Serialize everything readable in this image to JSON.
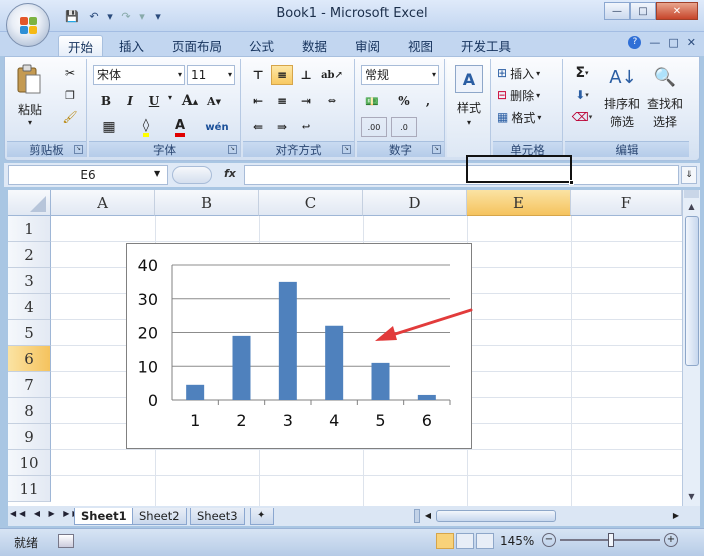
{
  "window": {
    "title": "Book1 - Microsoft Excel"
  },
  "tabs": [
    {
      "label": "开始",
      "active": true
    },
    {
      "label": "插入"
    },
    {
      "label": "页面布局"
    },
    {
      "label": "公式"
    },
    {
      "label": "数据"
    },
    {
      "label": "审阅"
    },
    {
      "label": "视图"
    },
    {
      "label": "开发工具"
    }
  ],
  "ribbon": {
    "clipboard": {
      "label": "剪贴板",
      "paste": "粘贴"
    },
    "font": {
      "label": "字体",
      "name": "宋体",
      "size": "11"
    },
    "alignment": {
      "label": "对齐方式"
    },
    "number": {
      "label": "数字",
      "format": "常规"
    },
    "styles": {
      "label": "样式"
    },
    "cells": {
      "label": "单元格",
      "insert": "插入",
      "delete": "删除",
      "format": "格式"
    },
    "editing": {
      "label": "编辑",
      "sort": "排序和",
      "sort2": "筛选",
      "find": "查找和",
      "find2": "选择"
    }
  },
  "formula_bar": {
    "name_box": "E6",
    "fx": "fx",
    "value": ""
  },
  "columns": [
    "A",
    "B",
    "C",
    "D",
    "E",
    "F"
  ],
  "rows": [
    "1",
    "2",
    "3",
    "4",
    "5",
    "6",
    "7",
    "8",
    "9",
    "10",
    "11"
  ],
  "selected": {
    "col": "E",
    "row": "6"
  },
  "chart_data": {
    "type": "bar",
    "categories": [
      "1",
      "2",
      "3",
      "4",
      "5",
      "6"
    ],
    "values": [
      4.5,
      19,
      35,
      22,
      11,
      1.5
    ],
    "ylim": [
      0,
      40
    ],
    "yticks": [
      0,
      10,
      20,
      30,
      40
    ],
    "grid": true,
    "color": "#4f81bd",
    "annotation_color": "#e23b3b"
  },
  "sheets": [
    {
      "label": "Sheet1",
      "active": true
    },
    {
      "label": "Sheet2"
    },
    {
      "label": "Sheet3"
    }
  ],
  "status": {
    "ready": "就绪",
    "zoom": "145%"
  }
}
